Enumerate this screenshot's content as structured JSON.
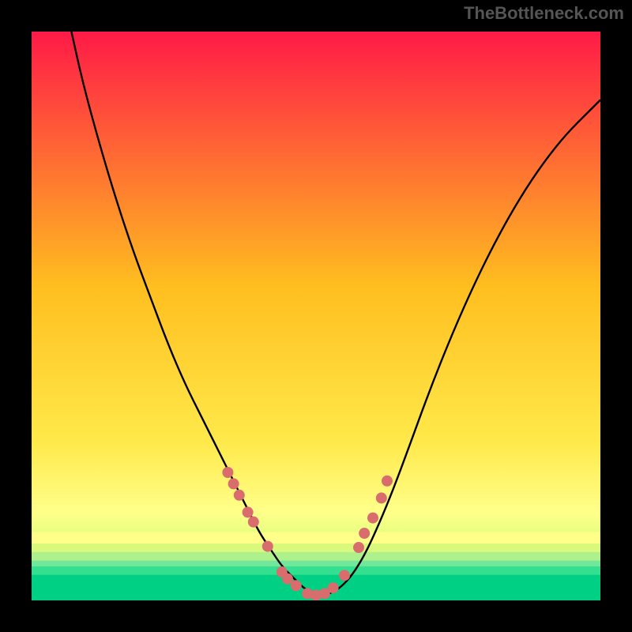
{
  "watermark": "TheBottleneck.com",
  "chart_data": {
    "type": "line",
    "title": "",
    "xlabel": "",
    "ylabel": "",
    "xlim": [
      0,
      100
    ],
    "ylim": [
      0,
      100
    ],
    "grid": false,
    "legend": false,
    "gradient_stops": [
      {
        "offset": 0.0,
        "color": "#ff1a47"
      },
      {
        "offset": 0.45,
        "color": "#ffbf1f"
      },
      {
        "offset": 0.72,
        "color": "#ffe94a"
      },
      {
        "offset": 0.845,
        "color": "#ffff8a"
      },
      {
        "offset": 0.9,
        "color": "#dcff7a"
      },
      {
        "offset": 0.933,
        "color": "#7aff7a"
      },
      {
        "offset": 0.95,
        "color": "#20e287"
      },
      {
        "offset": 1.0,
        "color": "#00d084"
      }
    ],
    "series": [
      {
        "name": "curve",
        "color": "#000000",
        "x": [
          7,
          9,
          12,
          15,
          18,
          21,
          24,
          27,
          30,
          33,
          36,
          38,
          40,
          42,
          44,
          46,
          48,
          50,
          52,
          54,
          56,
          58,
          60,
          63,
          66,
          70,
          74,
          78,
          82,
          86,
          90,
          94,
          98,
          100
        ],
        "y": [
          100,
          91,
          80,
          70,
          61,
          53,
          45,
          38,
          32,
          26,
          20,
          16,
          12,
          9,
          6,
          4,
          2,
          1,
          1,
          2,
          4,
          7,
          11,
          18,
          26,
          37,
          47,
          56,
          64,
          71,
          77,
          82,
          86,
          88
        ]
      },
      {
        "name": "dots",
        "type": "scatter",
        "color": "#d96d6d",
        "radius_px": 7,
        "x": [
          34.5,
          35.5,
          36.5,
          38.0,
          39.0,
          41.5,
          44.0,
          45.0,
          46.5,
          48.5,
          50.0,
          51.5,
          53.0,
          55.0,
          57.5,
          58.5,
          60.0,
          61.5,
          62.5
        ],
        "y": [
          22.5,
          20.5,
          18.5,
          15.5,
          13.8,
          9.5,
          5.0,
          3.8,
          2.6,
          1.2,
          0.9,
          1.2,
          2.2,
          4.4,
          9.3,
          11.8,
          14.5,
          18.0,
          21.0
        ]
      }
    ],
    "bottom_bands": [
      {
        "y": 0.0,
        "color": "#00d084"
      },
      {
        "y": 4.5,
        "color": "#34e090"
      },
      {
        "y": 6.0,
        "color": "#72e69a"
      },
      {
        "y": 7.0,
        "color": "#aef08c"
      },
      {
        "y": 8.5,
        "color": "#d9f97c"
      },
      {
        "y": 10.0,
        "color": "#ffff8a"
      }
    ]
  }
}
